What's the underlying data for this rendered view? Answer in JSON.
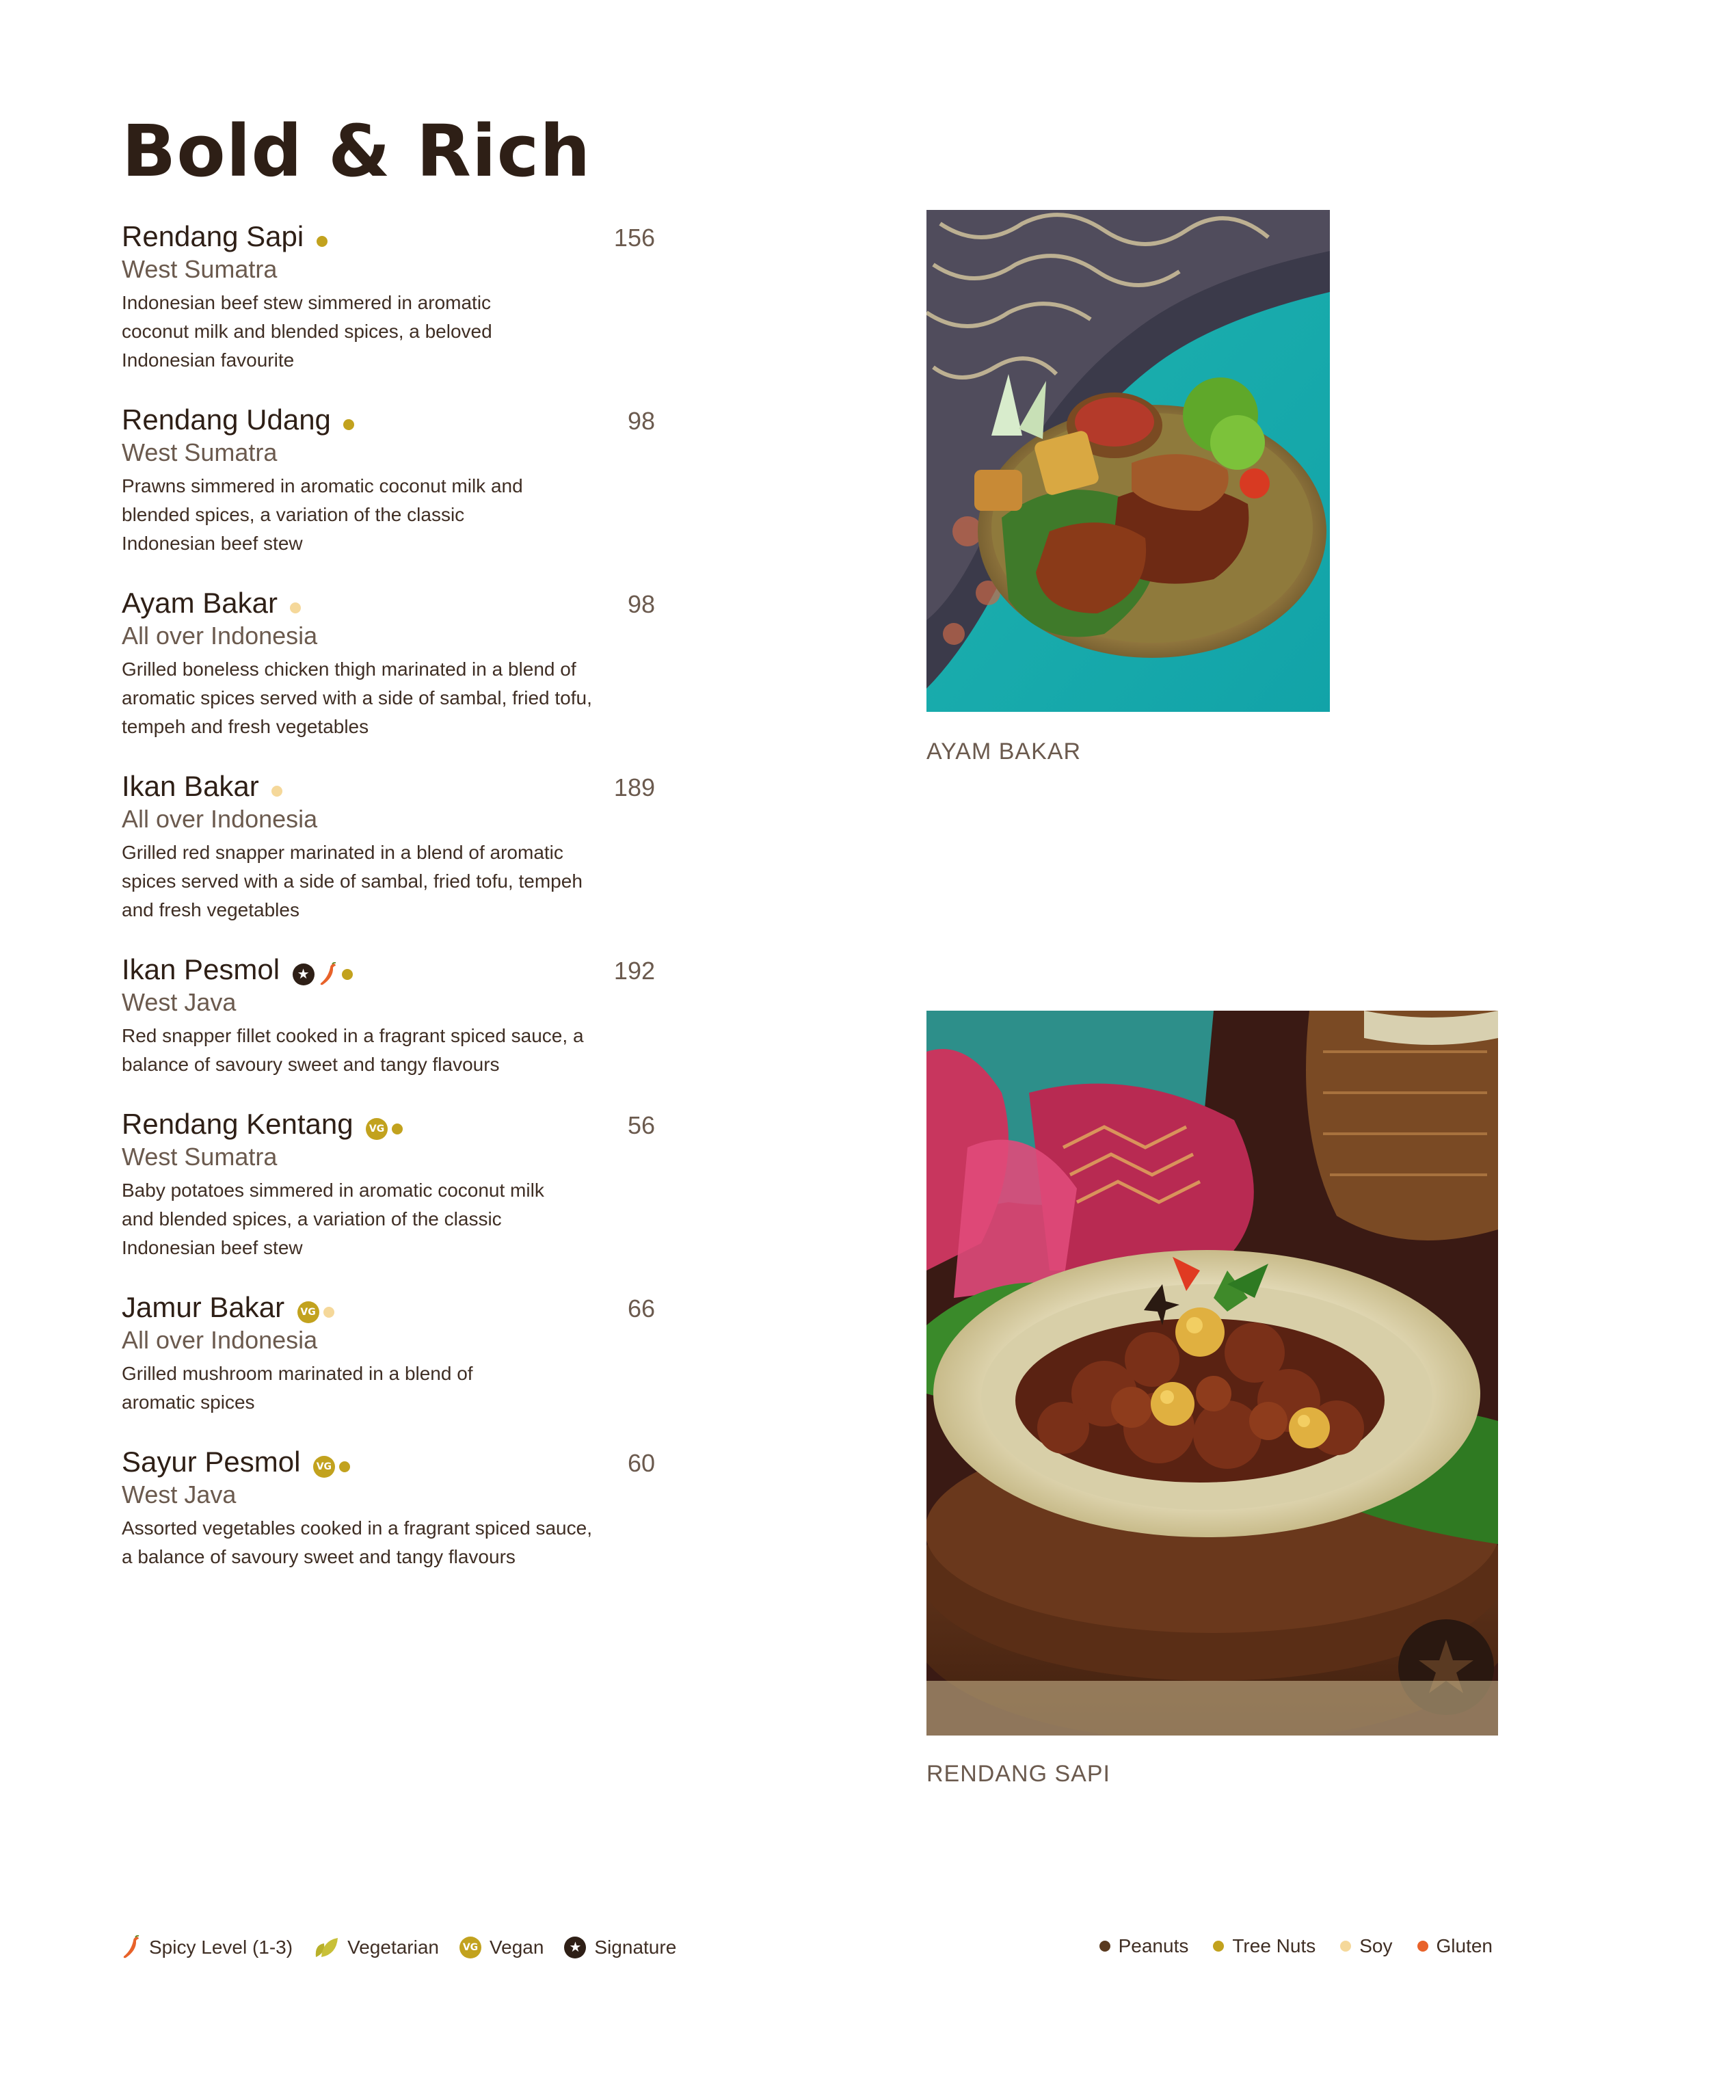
{
  "title": "Bold & Rich",
  "colors": {
    "peanuts": "#5a3a1f",
    "tree_nuts": "#c2a21e",
    "soy": "#f5d89a",
    "gluten": "#e8622a",
    "vegan": "#c2a21e",
    "signature": "#2e1f16",
    "spicy": "#e8622a",
    "vegetarian": "#b8b02a"
  },
  "items": [
    {
      "name": "Rendang Sapi",
      "price": "156",
      "region": "West Sumatra",
      "desc": "Indonesian beef stew simmered in aromatic coconut milk and blended spices, a beloved Indonesian favourite",
      "badges": [
        "tree-nuts-dot"
      ]
    },
    {
      "name": "Rendang Udang",
      "price": "98",
      "region": "West Sumatra",
      "desc": "Prawns simmered in aromatic coconut milk and blended spices, a variation of the classic Indonesian beef stew",
      "badges": [
        "tree-nuts-dot"
      ]
    },
    {
      "name": "Ayam Bakar",
      "price": "98",
      "region": "All over Indonesia",
      "desc": "Grilled boneless chicken thigh marinated in a blend of aromatic spices served with a side of sambal, fried tofu, tempeh and fresh vegetables",
      "badges": [
        "soy-dot"
      ]
    },
    {
      "name": "Ikan Bakar",
      "price": "189",
      "region": "All over Indonesia",
      "desc": "Grilled red snapper marinated in a blend of aromatic spices served with a side of sambal, fried tofu, tempeh and fresh vegetables",
      "badges": [
        "soy-dot"
      ]
    },
    {
      "name": "Ikan Pesmol",
      "price": "192",
      "region": "West Java",
      "desc": "Red snapper fillet cooked in a fragrant spiced sauce, a balance of savoury sweet and tangy flavours",
      "badges": [
        "signature-icon",
        "chili-icon",
        "tree-nuts-dot"
      ]
    },
    {
      "name": "Rendang Kentang",
      "price": "56",
      "region": "West Sumatra",
      "desc": "Baby potatoes simmered in aromatic coconut milk and blended spices, a variation of the classic Indonesian beef stew",
      "badges": [
        "vegan-icon",
        "tree-nuts-dot"
      ]
    },
    {
      "name": "Jamur Bakar",
      "price": "66",
      "region": "All over Indonesia",
      "desc": "Grilled mushroom marinated in a blend of aromatic spices",
      "badges": [
        "vegan-icon",
        "soy-dot"
      ]
    },
    {
      "name": "Sayur Pesmol",
      "price": "60",
      "region": "West Java",
      "desc": "Assorted vegetables cooked in a fragrant spiced sauce, a balance of savoury sweet and tangy flavours",
      "badges": [
        "vegan-icon",
        "tree-nuts-dot"
      ]
    }
  ],
  "photos": [
    {
      "caption": "AYAM BAKAR"
    },
    {
      "caption": "RENDANG SAPI"
    }
  ],
  "legend": {
    "vg_badge_text": "VG",
    "spicy": "Spicy Level (1-3)",
    "vegetarian": "Vegetarian",
    "vegan": "Vegan",
    "signature": "Signature",
    "peanuts": "Peanuts",
    "tree_nuts": "Tree Nuts",
    "soy": "Soy",
    "gluten": "Gluten"
  }
}
